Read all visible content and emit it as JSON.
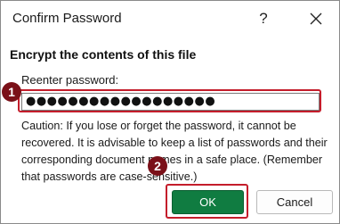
{
  "dialog": {
    "title": "Confirm Password",
    "help_label": "?",
    "heading": "Encrypt the contents of this file",
    "field_label": "Reenter password:",
    "password_value": "●●●●●●●●●●●●●●●●●●",
    "caution": "Caution: If you lose or forget the password, it cannot be recovered. It is advisable to keep a list of passwords and their corresponding document names in a safe place. (Remember that passwords are case-sensitive.)",
    "ok_label": "OK",
    "cancel_label": "Cancel"
  },
  "annotations": {
    "step1": "1",
    "step2": "2",
    "highlight_color": "#c41d2b",
    "badge_color": "#7a1018"
  },
  "colors": {
    "ok_button": "#107c41"
  },
  "icons": {
    "close": "close-icon"
  }
}
